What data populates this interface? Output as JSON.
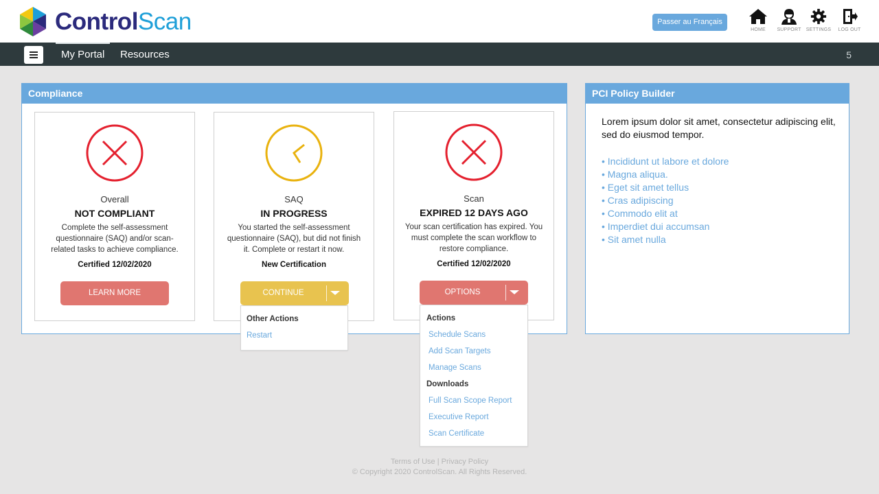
{
  "header": {
    "logo_text_a": "Control",
    "logo_text_b": "Scan",
    "lang_button": "Passer au Français",
    "icons": [
      {
        "name": "home-icon",
        "label": "HOME"
      },
      {
        "name": "support-icon",
        "label": "SUPPORT"
      },
      {
        "name": "settings-icon",
        "label": "SETTINGS"
      },
      {
        "name": "logout-icon",
        "label": "LOG OUT"
      }
    ]
  },
  "nav": {
    "items": [
      "My Portal",
      "Resources"
    ],
    "count": "5"
  },
  "compliance": {
    "title": "Compliance",
    "cards": [
      {
        "label": "Overall",
        "status": "NOT COMPLIANT",
        "desc": "Complete the self-assessment questionnaire (SAQ) and/or scan-related tasks to achieve compliance.",
        "cert": "Certified 12/02/2020",
        "button": "LEARN  MORE",
        "icon": "x-circle-icon"
      },
      {
        "label": "SAQ",
        "status": "IN PROGRESS",
        "desc": "You started the self-assessment questionnaire (SAQ), but did not finish it. Complete or restart it now.",
        "cert": "New Certification",
        "button": "CONTINUE",
        "icon": "clock-icon",
        "menu": {
          "heading": "Other Actions",
          "links": [
            "Restart"
          ]
        }
      },
      {
        "label": "Scan",
        "status": "EXPIRED 12 DAYS AGO",
        "desc": "Your scan certification has expired. You must complete the scan workflow to restore compliance.",
        "cert": "Certified 12/02/2020",
        "button": "OPTIONS",
        "icon": "x-circle-icon",
        "menu": {
          "actions_heading": "Actions",
          "actions": [
            "Schedule Scans",
            "Add Scan Targets",
            "Manage Scans"
          ],
          "downloads_heading": "Downloads",
          "downloads": [
            "Full Scan Scope Report",
            "Executive Report",
            "Scan Certificate"
          ]
        }
      }
    ]
  },
  "policy": {
    "title": "PCI Policy Builder",
    "intro": "Lorem ipsum dolor sit amet, consectetur adipiscing elit, sed do eiusmod tempor.",
    "items": [
      "• Incididunt ut labore et dolore",
      "• Magna aliqua.",
      "• Eget sit amet tellus",
      "• Cras adipiscing",
      "• Commodo  elit at",
      "• Imperdiet dui accumsan",
      "• Sit amet nulla"
    ]
  },
  "footer": {
    "terms": "Terms of Use",
    "separator": " | ",
    "privacy": "Privacy Policy",
    "copyright": "© Copyright 2020 ControlScan. All Rights Reserved."
  },
  "colors": {
    "accent_blue": "#69a8dd",
    "red": "#e4202e",
    "yellow": "#e9b20e",
    "nav_bg": "#2e3a3d"
  }
}
